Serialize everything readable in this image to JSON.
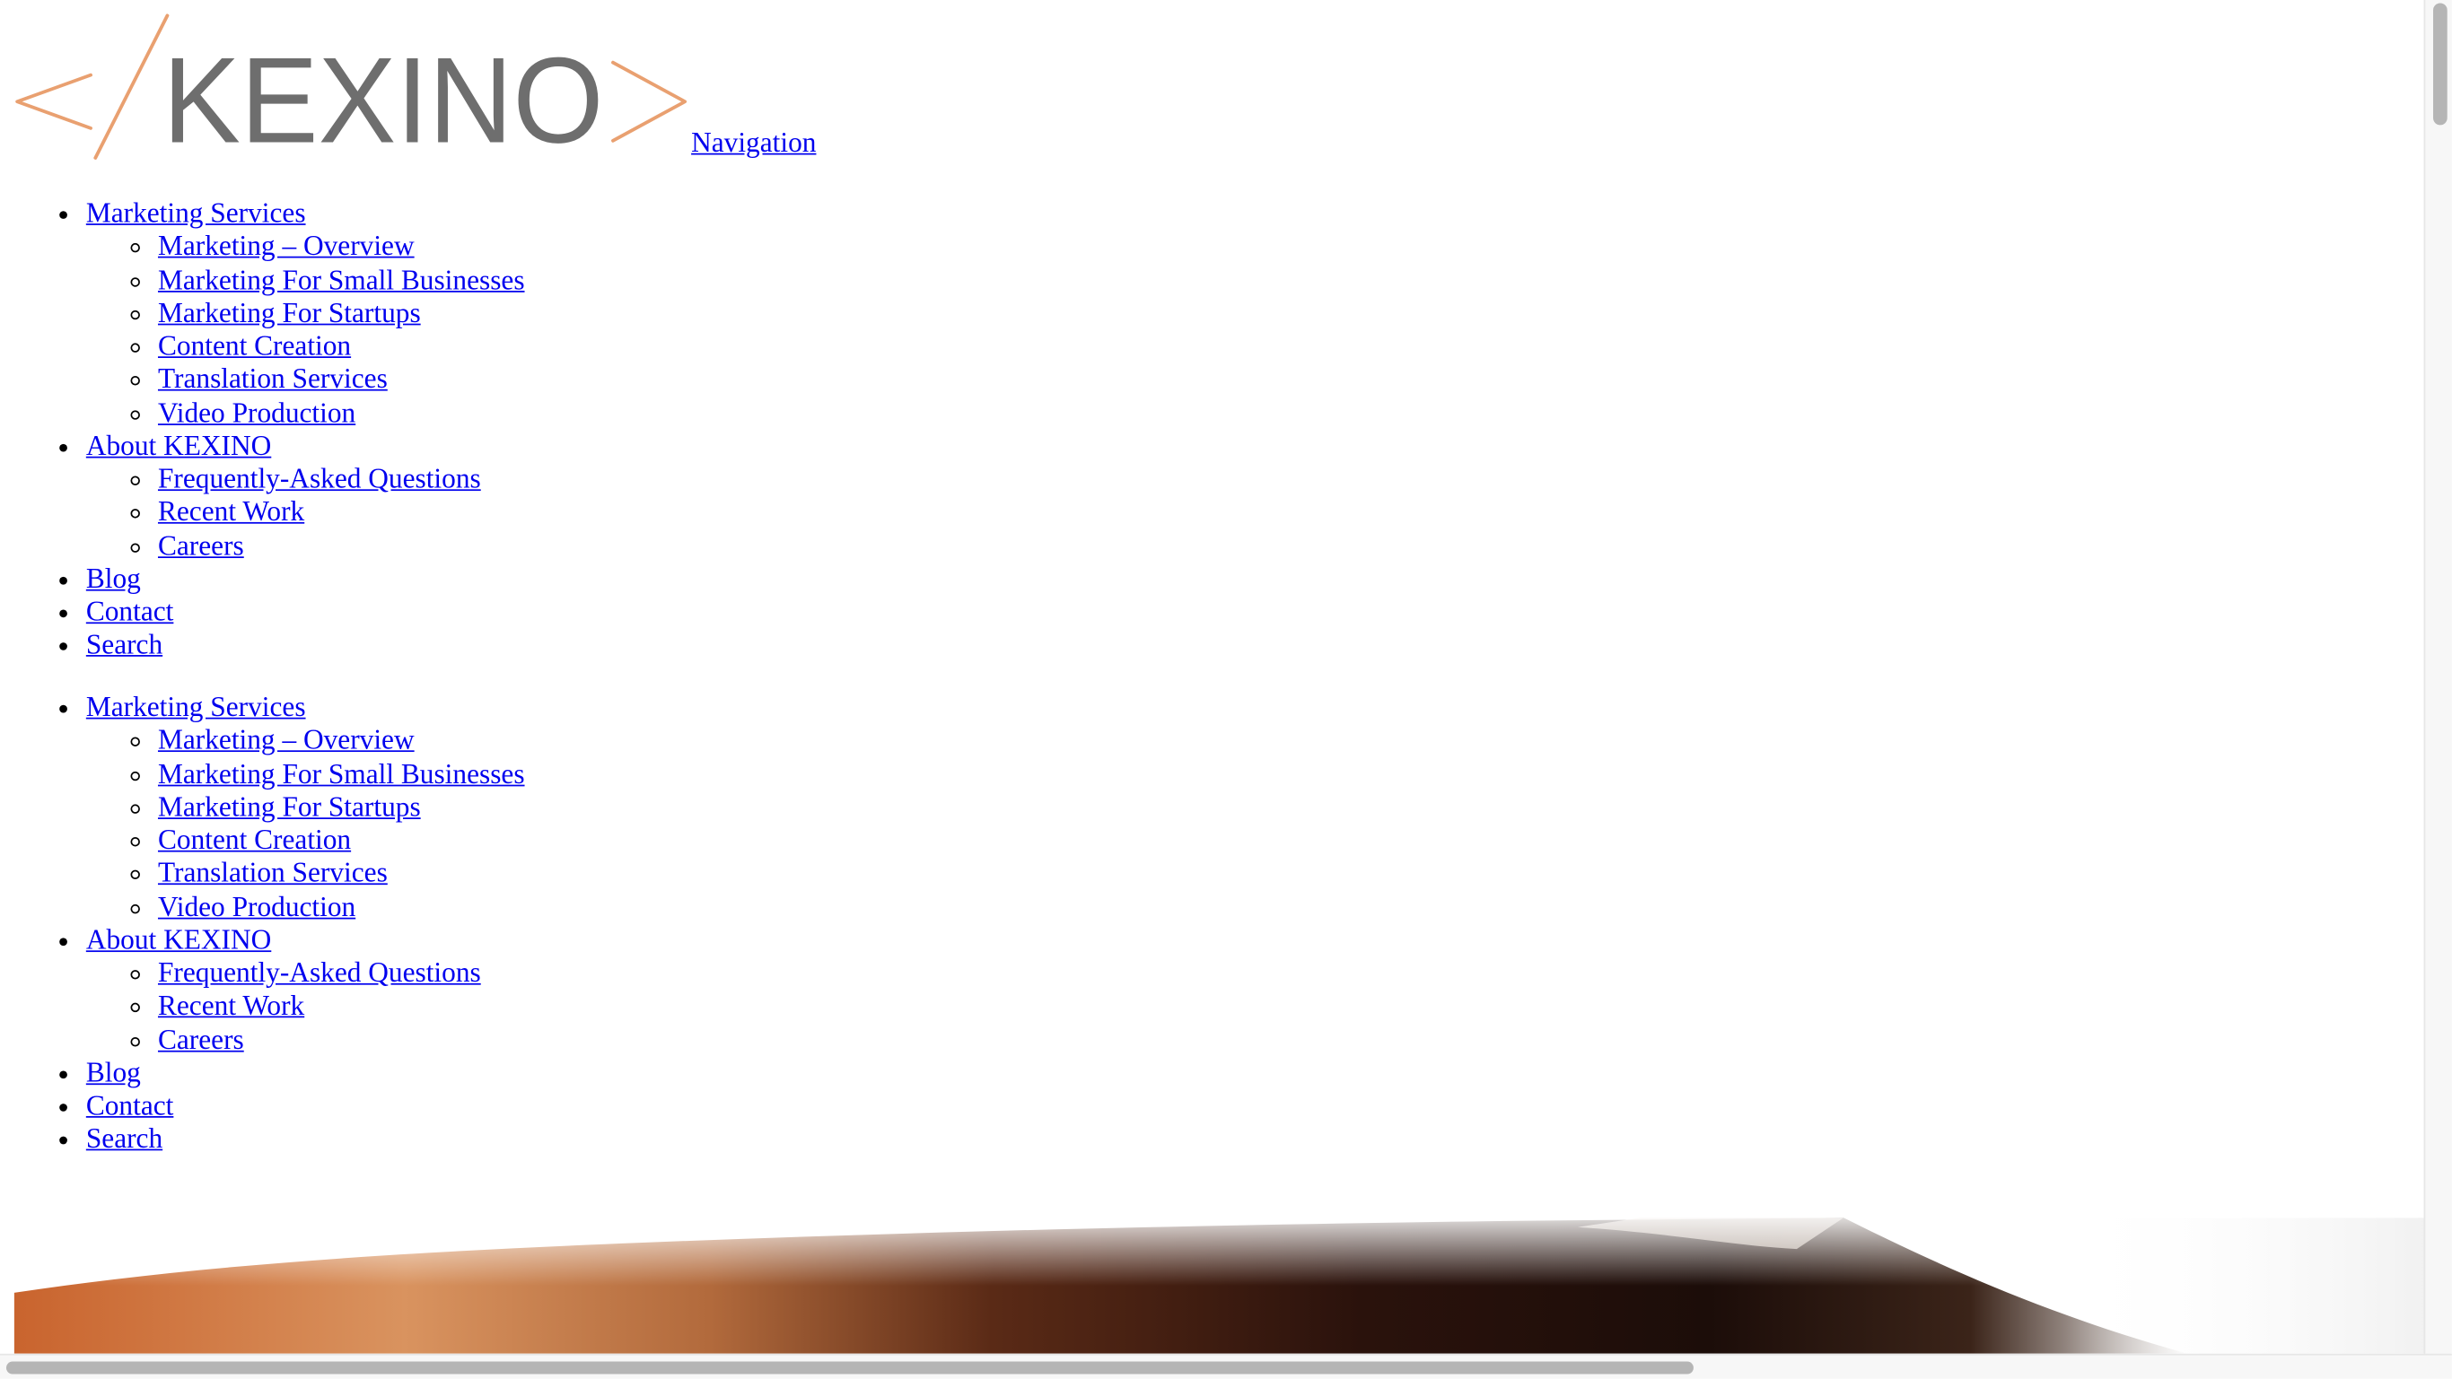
{
  "brand": {
    "logo_text": "KEXINO",
    "nav_label": "Navigation"
  },
  "menus": [
    {
      "items": [
        {
          "label": "Marketing Services",
          "children": [
            "Marketing – Overview",
            "Marketing For Small Businesses",
            "Marketing For Startups",
            "Content Creation",
            "Translation Services",
            "Video Production"
          ]
        },
        {
          "label": "About KEXINO",
          "children": [
            "Frequently-Asked Questions",
            "Recent Work",
            "Careers"
          ]
        },
        {
          "label": "Blog"
        },
        {
          "label": "Contact"
        },
        {
          "label": "Search"
        }
      ]
    },
    {
      "items": [
        {
          "label": "Marketing Services",
          "children": [
            "Marketing – Overview",
            "Marketing For Small Businesses",
            "Marketing For Startups",
            "Content Creation",
            "Translation Services",
            "Video Production"
          ]
        },
        {
          "label": "About KEXINO",
          "children": [
            "Frequently-Asked Questions",
            "Recent Work",
            "Careers"
          ]
        },
        {
          "label": "Blog"
        },
        {
          "label": "Contact"
        },
        {
          "label": "Search"
        }
      ]
    }
  ],
  "colors": {
    "logo_accent": "#e9a070",
    "logo_text": "#6e6e6e",
    "link": "#0000ee",
    "scroll_thumb": "#b5b5b5"
  }
}
